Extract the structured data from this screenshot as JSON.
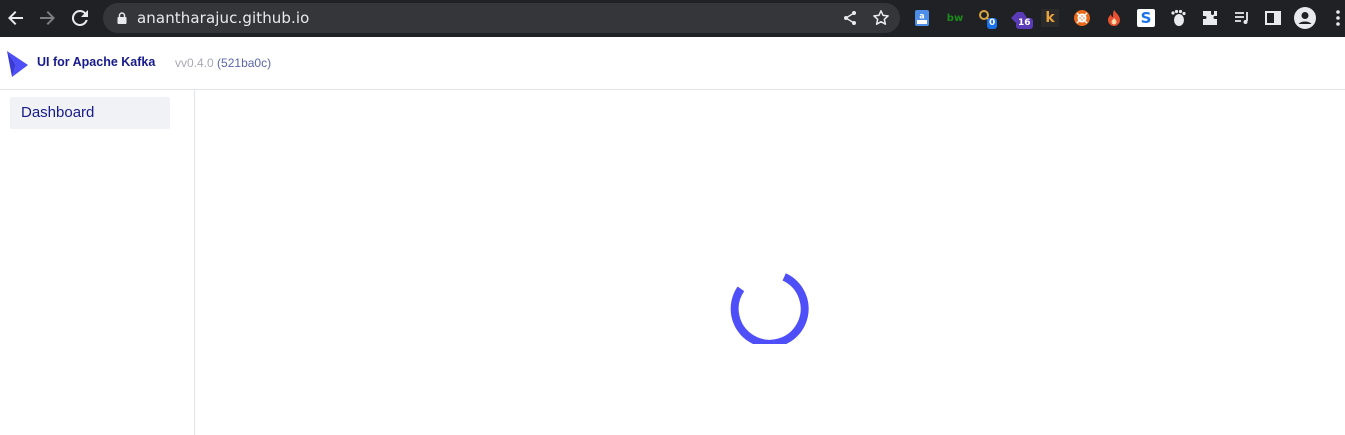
{
  "browser": {
    "url": "anantharajuc.github.io",
    "extensions": [
      {
        "name": "extension-a",
        "badge": ""
      },
      {
        "name": "extension-bw",
        "label": "bw",
        "badge": ""
      },
      {
        "name": "extension-key",
        "badge": "0"
      },
      {
        "name": "extension-puzzle-purple",
        "badge": "16"
      },
      {
        "name": "extension-k",
        "label": "k",
        "badge": ""
      },
      {
        "name": "extension-orange-circle",
        "badge": ""
      },
      {
        "name": "extension-flame",
        "badge": ""
      },
      {
        "name": "extension-s",
        "label": "S",
        "badge": ""
      }
    ],
    "colors": {
      "frame": "#202124",
      "omnibox": "#35363a",
      "text": "#e8eaed"
    }
  },
  "app": {
    "title": "UI for Apache Kafka",
    "version_label": "vv0.4.0",
    "version_hash": "(521ba0c)",
    "colors": {
      "brand": "#171a8c",
      "accent": "#4f4ffa"
    }
  },
  "sidebar": {
    "items": [
      {
        "label": "Dashboard",
        "active": true
      }
    ]
  },
  "main": {
    "state": "loading",
    "spinner_icon": "loading-spinner-icon"
  }
}
